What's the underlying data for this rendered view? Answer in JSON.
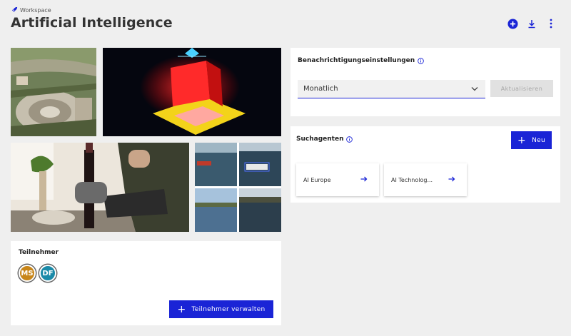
{
  "header": {
    "breadcrumb": "Workspace",
    "title": "Artificial Intelligence",
    "actions": [
      "add-circle-icon",
      "download-icon",
      "more-vertical-icon"
    ]
  },
  "participants": {
    "title": "Teilnehmer",
    "members": [
      {
        "initials": "MS",
        "color": "#c8861a"
      },
      {
        "initials": "DF",
        "color": "#1b8aa8"
      }
    ],
    "manage_label": "Teilnehmer verwalten"
  },
  "notifications": {
    "title": "Benachrichtigungseinstellungen",
    "selected": "Monatlich",
    "update_label": "Aktualisieren"
  },
  "agents": {
    "title": "Suchagenten",
    "new_label": "Neu",
    "items": [
      {
        "label": "AI Europe"
      },
      {
        "label": "AI Technolog..."
      }
    ]
  },
  "colors": {
    "accent": "#1a24d6",
    "background": "#efefef"
  }
}
